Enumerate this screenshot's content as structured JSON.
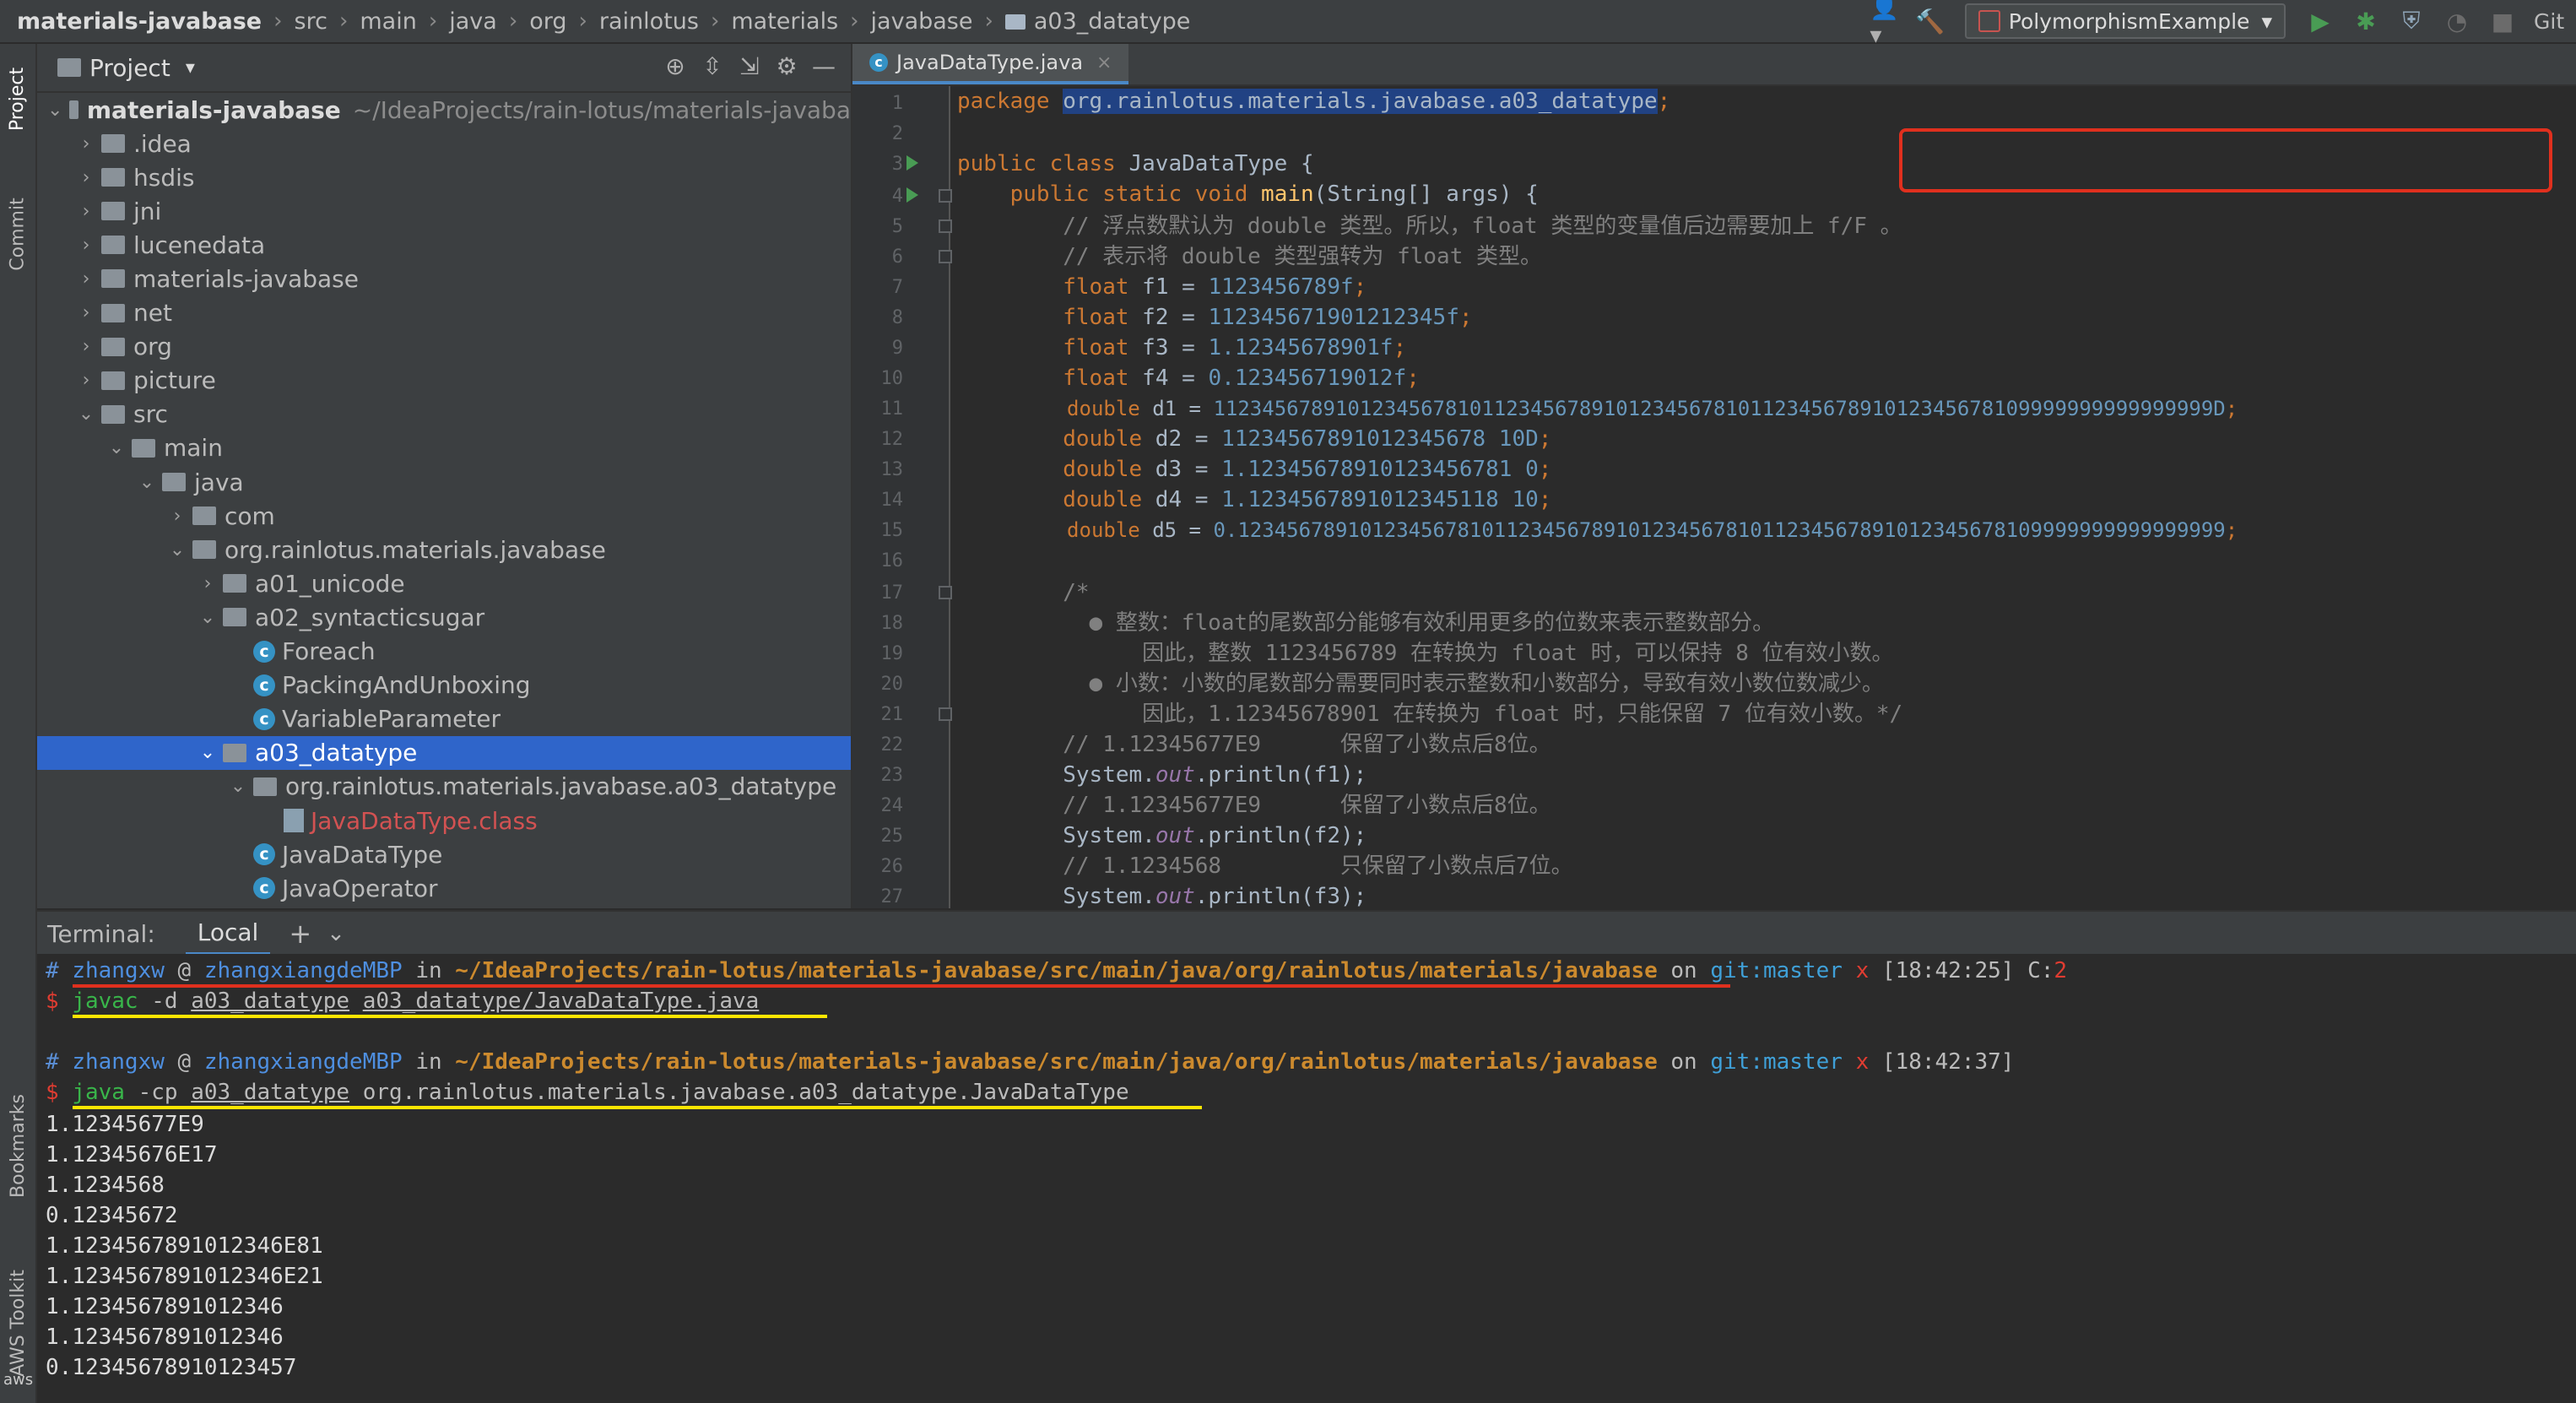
{
  "breadcrumbs": [
    "materials-javabase",
    "src",
    "main",
    "java",
    "org",
    "rainlotus",
    "materials",
    "javabase",
    "a03_datatype"
  ],
  "toolbar": {
    "run_config": "PolymorphismExample",
    "git_label": "Git"
  },
  "left_strip": {
    "project_tab": "Project",
    "commit_tab": "Commit",
    "bookmarks_tab": "Bookmarks",
    "aws_tab": "AWS Toolkit",
    "aws_logo": "aws"
  },
  "project_panel": {
    "title": "Project",
    "root_name": "materials-javabase",
    "root_path": "~/IdeaProjects/rain-lotus/materials-javaba",
    "tree": [
      {
        "label": ".idea",
        "depth": 1,
        "kind": "folder",
        "arrow": "right"
      },
      {
        "label": "hsdis",
        "depth": 1,
        "kind": "folder",
        "arrow": "right"
      },
      {
        "label": "jni",
        "depth": 1,
        "kind": "folder",
        "arrow": "right"
      },
      {
        "label": "lucenedata",
        "depth": 1,
        "kind": "folder",
        "arrow": "right"
      },
      {
        "label": "materials-javabase",
        "depth": 1,
        "kind": "folder",
        "arrow": "right"
      },
      {
        "label": "net",
        "depth": 1,
        "kind": "folder",
        "arrow": "right"
      },
      {
        "label": "org",
        "depth": 1,
        "kind": "folder",
        "arrow": "right"
      },
      {
        "label": "picture",
        "depth": 1,
        "kind": "folder",
        "arrow": "right"
      },
      {
        "label": "src",
        "depth": 1,
        "kind": "folder",
        "arrow": "down"
      },
      {
        "label": "main",
        "depth": 2,
        "kind": "folder",
        "arrow": "down"
      },
      {
        "label": "java",
        "depth": 3,
        "kind": "folder",
        "arrow": "down"
      },
      {
        "label": "com",
        "depth": 4,
        "kind": "pkg",
        "arrow": "right"
      },
      {
        "label": "org.rainlotus.materials.javabase",
        "depth": 4,
        "kind": "pkg",
        "arrow": "down"
      },
      {
        "label": "a01_unicode",
        "depth": 5,
        "kind": "pkg",
        "arrow": "right"
      },
      {
        "label": "a02_syntacticsugar",
        "depth": 5,
        "kind": "pkg",
        "arrow": "down"
      },
      {
        "label": "Foreach",
        "depth": 6,
        "kind": "class",
        "arrow": ""
      },
      {
        "label": "PackingAndUnboxing",
        "depth": 6,
        "kind": "class",
        "arrow": ""
      },
      {
        "label": "VariableParameter",
        "depth": 6,
        "kind": "class",
        "arrow": ""
      },
      {
        "label": "a03_datatype",
        "depth": 5,
        "kind": "pkg",
        "arrow": "down",
        "selected": true
      },
      {
        "label": "org.rainlotus.materials.javabase.a03_datatype",
        "depth": 6,
        "kind": "pkg",
        "arrow": "down"
      },
      {
        "label": "JavaDataType.class",
        "depth": 7,
        "kind": "classfile",
        "arrow": "",
        "red": true
      },
      {
        "label": "JavaDataType",
        "depth": 6,
        "kind": "class",
        "arrow": ""
      },
      {
        "label": "JavaOperator",
        "depth": 6,
        "kind": "class",
        "arrow": ""
      }
    ]
  },
  "editor": {
    "tab_title": "JavaDataType.java",
    "line_numbers": [
      "1",
      "2",
      "3",
      "4",
      "5",
      "6",
      "7",
      "8",
      "9",
      "10",
      "11",
      "12",
      "13",
      "14",
      "15",
      "16",
      "17",
      "18",
      "19",
      "20",
      "21",
      "22",
      "23",
      "24",
      "25",
      "26",
      "27"
    ],
    "code": {
      "l1_kw": "package",
      "l1_pkg": "org.rainlotus.materials.javabase.a03_datatype",
      "l1_semi": ";",
      "l3_kw": "public class",
      "l3_rest": " JavaDataType {",
      "l4_kw": "public static void",
      "l4_mth": "main",
      "l4_rest": "(String[] args) {",
      "l5": "// 浮点数默认为 double 类型。所以，float 类型的变量值后边需要加上 f/F 。",
      "l6": "// 表示将 double 类型强转为 float 类型。",
      "l7_kw": "float",
      "l7_mid": " f1 = ",
      "l7_num": "1123456789f",
      "l7_end": ";",
      "l8_kw": "float",
      "l8_mid": " f2 = ",
      "l8_num": "112345671901212345f",
      "l8_end": ";",
      "l9_kw": "float",
      "l9_mid": " f3 = ",
      "l9_num": "1.12345678901f",
      "l9_end": ";",
      "l10_kw": "float",
      "l10_mid": " f4 = ",
      "l10_num": "0.123456719012f",
      "l10_end": ";",
      "l11_kw": "double",
      "l11_mid": " d1 = ",
      "l11_num": "1123456789101234567810112345678910123456781011234567891012345678109999999999999999D",
      "l11_end": ";",
      "l12_kw": "double",
      "l12_mid": " d2 = ",
      "l12_num": "11234567891012345678 10D",
      "l12_end": ";",
      "l13_kw": "double",
      "l13_mid": " d3 = ",
      "l13_num": "1.12345678910123456781 0",
      "l13_end": ";",
      "l14_kw": "double",
      "l14_mid": " d4 = ",
      "l14_num": "1.1234567891012345118 10",
      "l14_end": ";",
      "l15_kw": "double",
      "l15_mid": " d5 = ",
      "l15_num": "0.123456789101234567810112345678910123456781011234567891012345678109999999999999999",
      "l15_end": ";",
      "l17": "/*",
      "l18": "● 整数：float的尾数部分能够有效利用更多的位数来表示整数部分。",
      "l19": "因此，整数 1123456789 在转换为 float 时，可以保持 8 位有效小数。",
      "l20": "● 小数：小数的尾数部分需要同时表示整数和小数部分，导致有效小数位数减少。",
      "l21": "因此，1.12345678901 在转换为 float 时，只能保留 7 位有效小数。*/",
      "l22": "// 1.12345677E9      保留了小数点后8位。",
      "l23_a": "System.",
      "l23_f": "out",
      "l23_b": ".println(f1);",
      "l24": "// 1.12345677E9      保留了小数点后8位。",
      "l25_a": "System.",
      "l25_f": "out",
      "l25_b": ".println(f2);",
      "l26": "// 1.1234568         只保留了小数点后7位。",
      "l27_a": "System.",
      "l27_f": "out",
      "l27_b": ".println(f3);"
    }
  },
  "terminal": {
    "label": "Terminal:",
    "tab": "Local",
    "prompt1": {
      "hash": "#",
      "user": "zhangxw",
      "at": "@",
      "host": "zhangxiangdeMBP",
      "in": "in",
      "path": "~/IdeaProjects/rain-lotus/materials-javabase/src/main/java/org/rainlotus/materials/javabase",
      "on": "on",
      "git": "git:master",
      "x": "x",
      "time": "[18:42:25]",
      "c": "C:",
      "c_val": "2"
    },
    "cmd1": {
      "dollar": "$",
      "bin": "javac",
      "args_plain": " -d ",
      "arg1": "a03_datatype",
      "sp": " ",
      "arg2": "a03_datatype/JavaDataType.java"
    },
    "prompt2": {
      "hash": "#",
      "user": "zhangxw",
      "at": "@",
      "host": "zhangxiangdeMBP",
      "in": "in",
      "path": "~/IdeaProjects/rain-lotus/materials-javabase/src/main/java/org/rainlotus/materials/javabase",
      "on": "on",
      "git": "git:master",
      "x": "x",
      "time": "[18:42:37]"
    },
    "cmd2": {
      "dollar": "$",
      "bin": "java",
      "args_plain": " -cp ",
      "arg1": "a03_datatype",
      "sp": " ",
      "arg2": "org.rainlotus.materials.javabase.a03_datatype.JavaDataType"
    },
    "output": [
      "1.12345677E9",
      "1.12345676E17",
      "1.1234568",
      "0.12345672",
      "1.1234567891012346E81",
      "1.1234567891012346E21",
      "1.1234567891012346",
      "1.1234567891012346",
      "0.12345678910123457"
    ]
  }
}
